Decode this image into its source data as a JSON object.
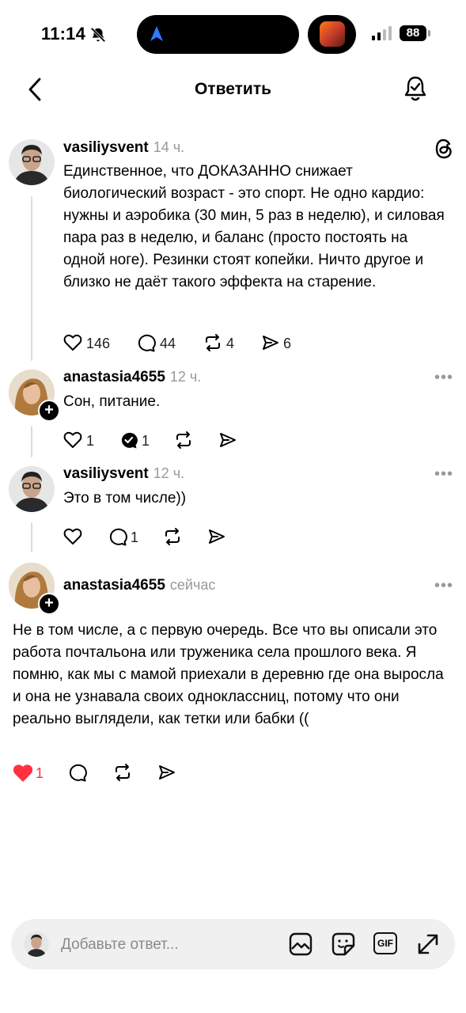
{
  "status": {
    "time": "11:14",
    "battery": "88"
  },
  "header": {
    "title": "Ответить"
  },
  "posts": [
    {
      "username": "vasiliysvent",
      "time": "14 ч.",
      "text": "Единственное, что ДОКАЗАННО снижает биологический возраст - это спорт. Не одно кардио: нужны и аэробика (30 мин, 5 раз в неделю), и силовая пара раз в неделю, и баланс (просто постоять на одной ноге). Резинки стоят копейки. Ничто другое и близко не даёт такого эффекта на старение.",
      "likes": "146",
      "replies": "44",
      "reposts": "4",
      "shares": "6"
    },
    {
      "username": "anastasia4655",
      "time": "12 ч.",
      "text": "Сон, питание.",
      "likes": "1",
      "replies": "1"
    },
    {
      "username": "vasiliysvent",
      "time": "12 ч.",
      "text": "Это в том числе))",
      "replies": "1"
    },
    {
      "username": "anastasia4655",
      "time": "сейчас",
      "text": "Не в том числе, а с первую очередь. Все что вы описали это работа почтальона или труженика села прошлого века. Я помню, как мы с мамой приехали  в деревню где она выросла и она не узнавала своих одноклассниц, потому что они реально выглядели, как тетки или бабки ((",
      "likes": "1"
    }
  ],
  "reply_bar": {
    "placeholder": "Добавьте ответ...",
    "gif_label": "GIF"
  },
  "colors": {
    "like_active": "#ff3040",
    "muted": "#999999",
    "reply_bg": "#f0f0f0"
  }
}
